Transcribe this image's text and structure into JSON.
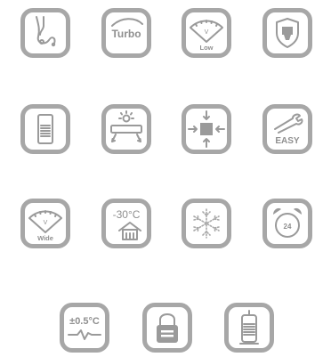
{
  "icons": {
    "turbo": {
      "label": "Turbo"
    },
    "low_fan": {
      "label": "Low",
      "needle": "V"
    },
    "easy_clean": {
      "label": "EASY"
    },
    "wide_fan": {
      "label": "Wide",
      "needle": "V"
    },
    "low_temp": {
      "label": "-30°C"
    },
    "timer": {
      "label": "24"
    },
    "precision": {
      "label": "±0.5°C"
    }
  }
}
